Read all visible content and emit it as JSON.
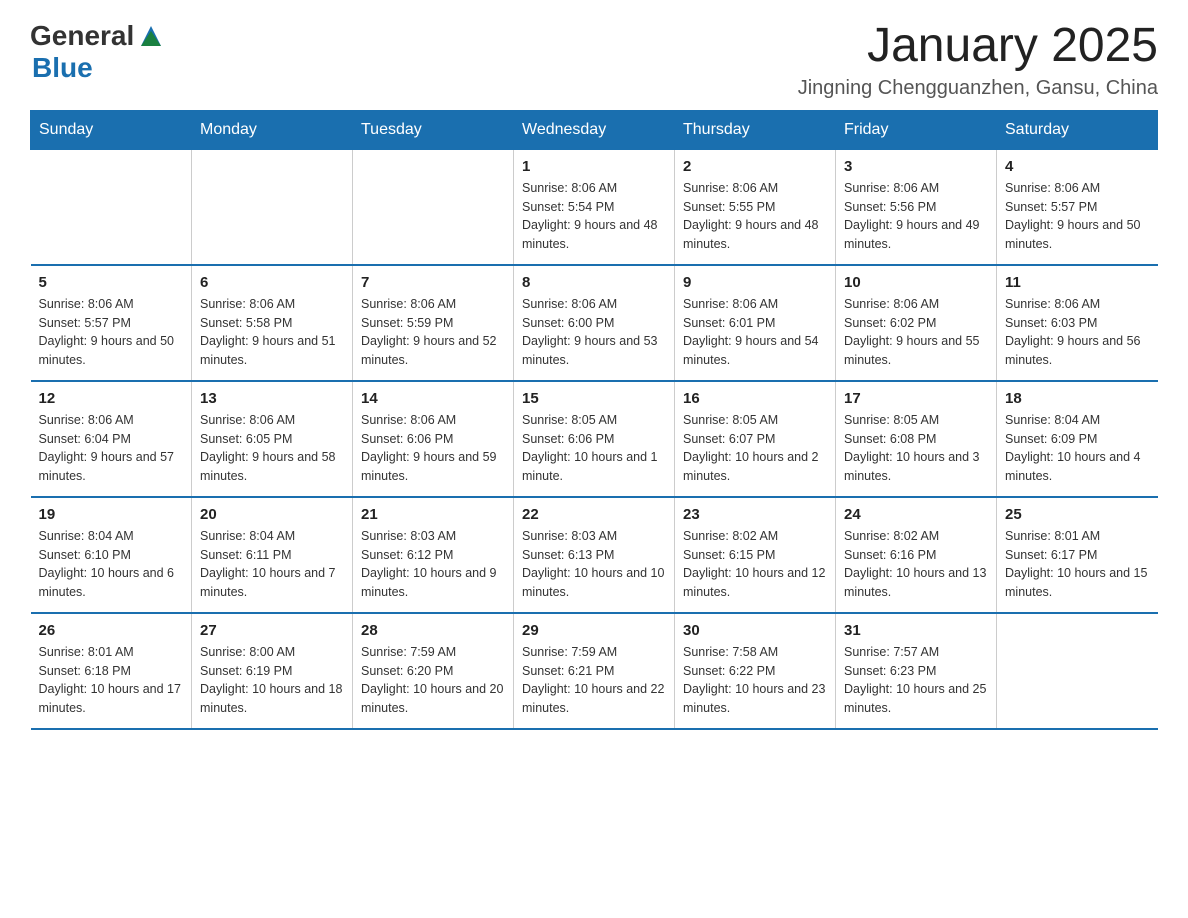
{
  "header": {
    "logo_general": "General",
    "logo_blue": "Blue",
    "title": "January 2025",
    "location": "Jingning Chengguanzhen, Gansu, China"
  },
  "days_of_week": [
    "Sunday",
    "Monday",
    "Tuesday",
    "Wednesday",
    "Thursday",
    "Friday",
    "Saturday"
  ],
  "weeks": [
    [
      {
        "day": "",
        "info": ""
      },
      {
        "day": "",
        "info": ""
      },
      {
        "day": "",
        "info": ""
      },
      {
        "day": "1",
        "info": "Sunrise: 8:06 AM\nSunset: 5:54 PM\nDaylight: 9 hours and 48 minutes."
      },
      {
        "day": "2",
        "info": "Sunrise: 8:06 AM\nSunset: 5:55 PM\nDaylight: 9 hours and 48 minutes."
      },
      {
        "day": "3",
        "info": "Sunrise: 8:06 AM\nSunset: 5:56 PM\nDaylight: 9 hours and 49 minutes."
      },
      {
        "day": "4",
        "info": "Sunrise: 8:06 AM\nSunset: 5:57 PM\nDaylight: 9 hours and 50 minutes."
      }
    ],
    [
      {
        "day": "5",
        "info": "Sunrise: 8:06 AM\nSunset: 5:57 PM\nDaylight: 9 hours and 50 minutes."
      },
      {
        "day": "6",
        "info": "Sunrise: 8:06 AM\nSunset: 5:58 PM\nDaylight: 9 hours and 51 minutes."
      },
      {
        "day": "7",
        "info": "Sunrise: 8:06 AM\nSunset: 5:59 PM\nDaylight: 9 hours and 52 minutes."
      },
      {
        "day": "8",
        "info": "Sunrise: 8:06 AM\nSunset: 6:00 PM\nDaylight: 9 hours and 53 minutes."
      },
      {
        "day": "9",
        "info": "Sunrise: 8:06 AM\nSunset: 6:01 PM\nDaylight: 9 hours and 54 minutes."
      },
      {
        "day": "10",
        "info": "Sunrise: 8:06 AM\nSunset: 6:02 PM\nDaylight: 9 hours and 55 minutes."
      },
      {
        "day": "11",
        "info": "Sunrise: 8:06 AM\nSunset: 6:03 PM\nDaylight: 9 hours and 56 minutes."
      }
    ],
    [
      {
        "day": "12",
        "info": "Sunrise: 8:06 AM\nSunset: 6:04 PM\nDaylight: 9 hours and 57 minutes."
      },
      {
        "day": "13",
        "info": "Sunrise: 8:06 AM\nSunset: 6:05 PM\nDaylight: 9 hours and 58 minutes."
      },
      {
        "day": "14",
        "info": "Sunrise: 8:06 AM\nSunset: 6:06 PM\nDaylight: 9 hours and 59 minutes."
      },
      {
        "day": "15",
        "info": "Sunrise: 8:05 AM\nSunset: 6:06 PM\nDaylight: 10 hours and 1 minute."
      },
      {
        "day": "16",
        "info": "Sunrise: 8:05 AM\nSunset: 6:07 PM\nDaylight: 10 hours and 2 minutes."
      },
      {
        "day": "17",
        "info": "Sunrise: 8:05 AM\nSunset: 6:08 PM\nDaylight: 10 hours and 3 minutes."
      },
      {
        "day": "18",
        "info": "Sunrise: 8:04 AM\nSunset: 6:09 PM\nDaylight: 10 hours and 4 minutes."
      }
    ],
    [
      {
        "day": "19",
        "info": "Sunrise: 8:04 AM\nSunset: 6:10 PM\nDaylight: 10 hours and 6 minutes."
      },
      {
        "day": "20",
        "info": "Sunrise: 8:04 AM\nSunset: 6:11 PM\nDaylight: 10 hours and 7 minutes."
      },
      {
        "day": "21",
        "info": "Sunrise: 8:03 AM\nSunset: 6:12 PM\nDaylight: 10 hours and 9 minutes."
      },
      {
        "day": "22",
        "info": "Sunrise: 8:03 AM\nSunset: 6:13 PM\nDaylight: 10 hours and 10 minutes."
      },
      {
        "day": "23",
        "info": "Sunrise: 8:02 AM\nSunset: 6:15 PM\nDaylight: 10 hours and 12 minutes."
      },
      {
        "day": "24",
        "info": "Sunrise: 8:02 AM\nSunset: 6:16 PM\nDaylight: 10 hours and 13 minutes."
      },
      {
        "day": "25",
        "info": "Sunrise: 8:01 AM\nSunset: 6:17 PM\nDaylight: 10 hours and 15 minutes."
      }
    ],
    [
      {
        "day": "26",
        "info": "Sunrise: 8:01 AM\nSunset: 6:18 PM\nDaylight: 10 hours and 17 minutes."
      },
      {
        "day": "27",
        "info": "Sunrise: 8:00 AM\nSunset: 6:19 PM\nDaylight: 10 hours and 18 minutes."
      },
      {
        "day": "28",
        "info": "Sunrise: 7:59 AM\nSunset: 6:20 PM\nDaylight: 10 hours and 20 minutes."
      },
      {
        "day": "29",
        "info": "Sunrise: 7:59 AM\nSunset: 6:21 PM\nDaylight: 10 hours and 22 minutes."
      },
      {
        "day": "30",
        "info": "Sunrise: 7:58 AM\nSunset: 6:22 PM\nDaylight: 10 hours and 23 minutes."
      },
      {
        "day": "31",
        "info": "Sunrise: 7:57 AM\nSunset: 6:23 PM\nDaylight: 10 hours and 25 minutes."
      },
      {
        "day": "",
        "info": ""
      }
    ]
  ]
}
